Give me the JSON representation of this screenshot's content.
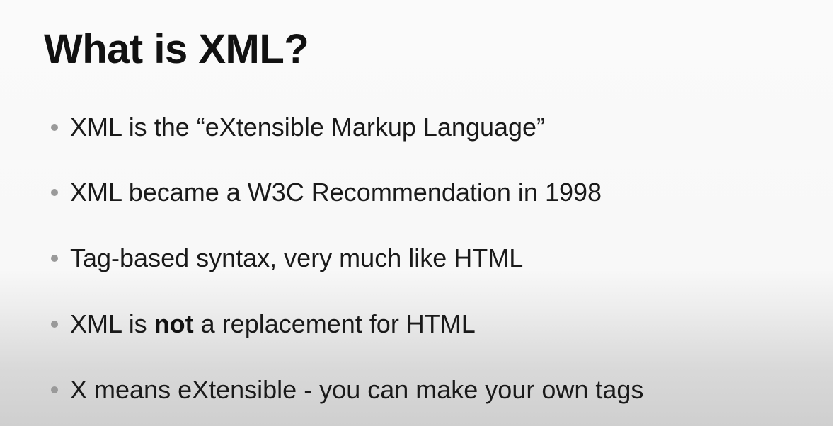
{
  "slide": {
    "title": "What is XML?",
    "bullets": [
      {
        "text": "XML is the “eXtensible Markup Language”"
      },
      {
        "text": "XML became a W3C Recommendation in 1998"
      },
      {
        "text": "Tag-based syntax, very much like HTML"
      },
      {
        "before": "XML is ",
        "bold": "not",
        "after": " a replacement for HTML"
      },
      {
        "text": "X means eXtensible - you can make your own tags"
      }
    ]
  }
}
